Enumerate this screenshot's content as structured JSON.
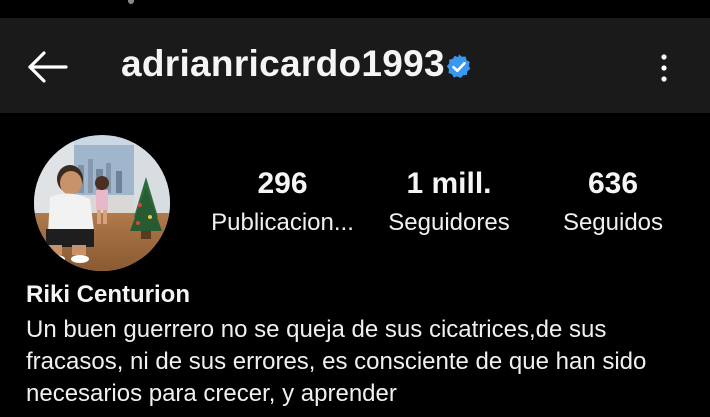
{
  "header": {
    "username": "adrianricardo1993",
    "verified": true,
    "back_icon": "arrow-left-icon",
    "more_icon": "more-vertical-icon"
  },
  "profile": {
    "full_name": "Riki Centurion",
    "bio": "Un buen guerrero no se queja de sus cicatrices,de sus fracasos, ni de sus errores, es consciente de que han sido necesarios para crecer, y aprender",
    "stats": [
      {
        "value": "296",
        "label": "Publicacion..."
      },
      {
        "value": "1 mill.",
        "label": "Seguidores"
      },
      {
        "value": "636",
        "label": "Seguidos"
      }
    ]
  },
  "colors": {
    "background": "#000000",
    "top_bar": "#1a1a1a",
    "verified_blue": "#3897f0",
    "text": "#f5f5f5"
  }
}
